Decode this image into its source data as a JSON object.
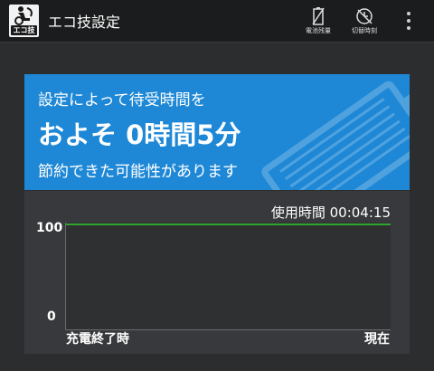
{
  "app": {
    "title": "エコ技設定",
    "icon_label": "エコ技"
  },
  "actions": [
    {
      "label": "電池残量",
      "icon": "battery-crossed-icon"
    },
    {
      "label": "切替時刻",
      "icon": "clock-crossed-icon"
    }
  ],
  "banner": {
    "line1": "設定によって待受時間を",
    "line2": "およそ 0時間5分",
    "line3": "節約できた可能性があります"
  },
  "usage": {
    "label": "使用時間 00:04:15"
  },
  "chart_data": {
    "type": "line",
    "xlabels": [
      "充電終了時",
      "現在"
    ],
    "ytick_labels": [
      "100",
      "0"
    ],
    "ylim": [
      0,
      100
    ],
    "series": [
      {
        "values": [
          100,
          100
        ],
        "color": "#2ecc2e"
      }
    ],
    "grid": false
  },
  "colors": {
    "banner": "#1e88d6",
    "line": "#2ecc2e"
  }
}
